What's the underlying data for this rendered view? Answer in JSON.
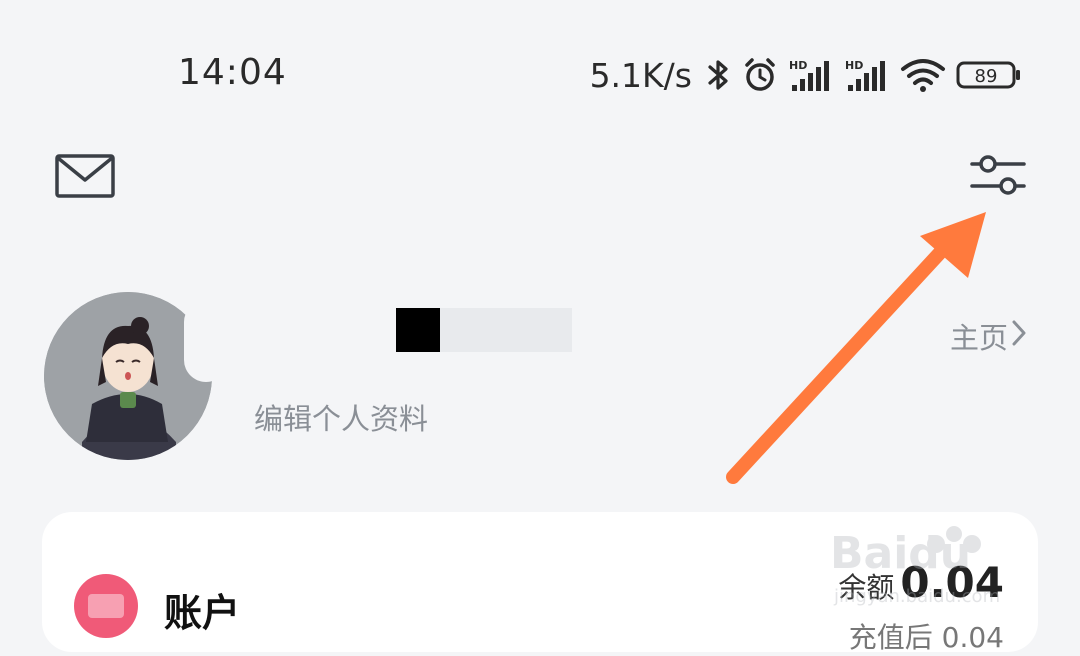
{
  "status_bar": {
    "time": "14:04",
    "net_speed": "5.1K/s",
    "battery": "89",
    "icons": [
      "bluetooth-icon",
      "alarm-icon",
      "hd-signal-icon",
      "hd-signal-icon",
      "wifi-icon",
      "battery-icon"
    ]
  },
  "top_bar": {
    "mail_icon": "mail-icon",
    "settings_icon": "settings-sliders-icon"
  },
  "profile": {
    "edit_label": "编辑个人资料",
    "homepage_label": "主页",
    "homepage_chevron": "›"
  },
  "account_card": {
    "title": "账户",
    "balance_label": "余额",
    "balance_value": "0.04",
    "secondary": "充值后 0.04"
  },
  "annotation": {
    "arrow_color": "#ff7a3d"
  }
}
